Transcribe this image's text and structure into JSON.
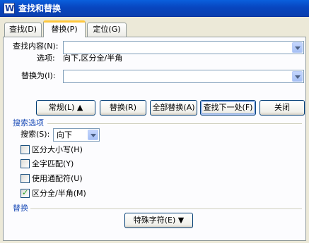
{
  "window": {
    "title": "查找和替换"
  },
  "tabs": [
    {
      "label": "查找(D)"
    },
    {
      "label": "替换(P)"
    },
    {
      "label": "定位(G)"
    }
  ],
  "find": {
    "label": "查找内容(N):",
    "value": "",
    "options_label": "选项:",
    "options_value": "向下,区分全/半角"
  },
  "replace": {
    "label": "替换为(I):",
    "value": ""
  },
  "buttons": {
    "normal": "常规(L) ▲",
    "replace": "替换(R)",
    "replace_all": "全部替换(A)",
    "find_next": "查找下一处(F)",
    "close": "关闭"
  },
  "search_options": {
    "title": "搜索选项",
    "search_label": "搜索(S):",
    "direction": "向下",
    "checkboxes": [
      {
        "label": "区分大小写(H)",
        "checked": false
      },
      {
        "label": "全字匹配(Y)",
        "checked": false
      },
      {
        "label": "使用通配符(U)",
        "checked": false
      },
      {
        "label": "区分全/半角(M)",
        "checked": true
      }
    ]
  },
  "replace_section": {
    "title": "替换",
    "special_button": "特殊字符(E) ▼"
  }
}
